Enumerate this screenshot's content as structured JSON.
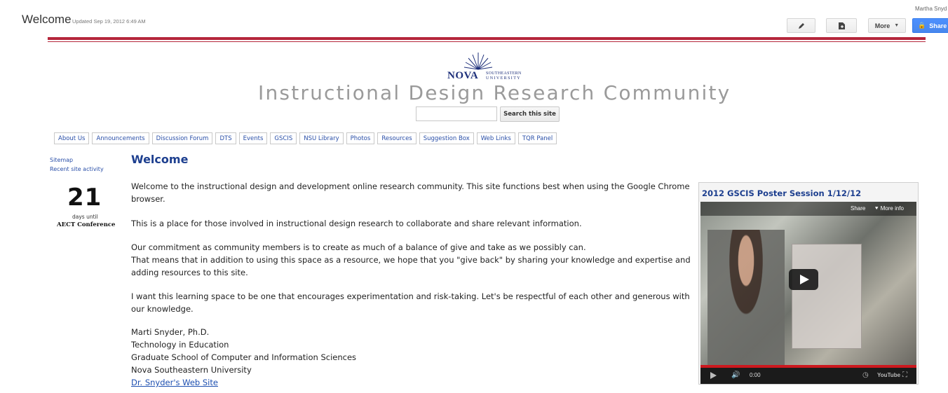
{
  "admin": {
    "page_name": "Welcome",
    "updated": "Updated Sep 19, 2012 6:49 AM",
    "user": "Martha Snyd",
    "edit_icon": "pencil-icon",
    "new_page_icon": "new-page-icon",
    "more_label": "More",
    "share_label": "Share"
  },
  "header": {
    "logo_nova": "NOVA",
    "logo_sub1": "SOUTHEASTERN",
    "logo_sub2": "UNIVERSITY",
    "site_title": "Instructional Design Research Community",
    "search_placeholder": "",
    "search_button": "Search this site"
  },
  "nav": {
    "items": [
      "About Us",
      "Announcements",
      "Discussion Forum",
      "DTS",
      "Events",
      "GSCIS",
      "NSU Library",
      "Photos",
      "Resources",
      "Suggestion Box",
      "Web Links",
      "TQR Panel"
    ]
  },
  "sidebar": {
    "sitemap": "Sitemap",
    "recent_activity": "Recent site activity",
    "countdown_number": "21",
    "countdown_days": "days until",
    "countdown_event": "AECT Conference"
  },
  "main": {
    "title": "Welcome",
    "para1": "Welcome to the instructional design and development online research community. This site functions best when using the  Google Chrome browser.",
    "para2": "This is a place for those involved in instructional design research to collaborate and share relevant information.",
    "para3a": "Our commitment as community members is to create as much of a balance of give and take as we possibly can.",
    "para3b": "That means that in addition to using this space as a resource, we hope that you \"give back\" by sharing your knowledge and expertise and adding resources to this site.",
    "para4": "I want this learning space to be one that encourages experimentation and risk-taking. Let's be respectful of each other and generous with our knowledge.",
    "sig_name": "Marti Snyder, Ph.D.",
    "sig_dept": "Technology in Education",
    "sig_school": "Graduate School of Computer and Information Sciences",
    "sig_univ": "Nova Southeastern University",
    "sig_link": "Dr. Snyder's Web Site"
  },
  "video": {
    "title": "2012 GSCIS Poster Session 1/12/12",
    "share": "Share",
    "more_info": "More info",
    "time": "0:00",
    "youtube": "YouTube",
    "progress": 0
  },
  "colors": {
    "accent_red": "#b5263b",
    "link_blue": "#2a4fa8",
    "title_blue": "#1d3f8f",
    "share_blue": "#4d90fe"
  }
}
